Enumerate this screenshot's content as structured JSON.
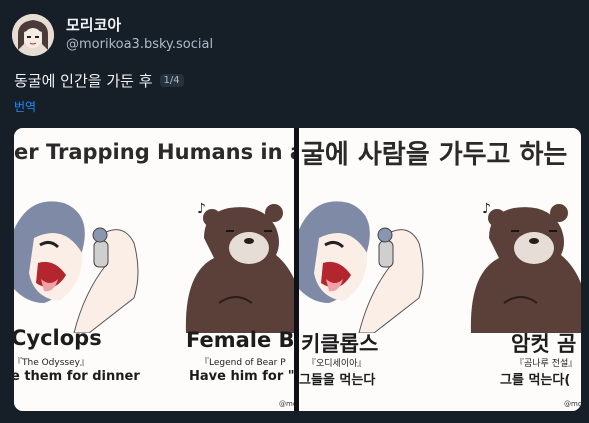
{
  "post": {
    "display_name": "모리코아",
    "handle": "@morikoa3.bsky.social",
    "text": "동굴에 인간을 가둔 후",
    "image_counter": "1/4",
    "translate_label": "번역"
  },
  "image": {
    "english_panel": {
      "headline": "ter Trapping Humans in a Ca",
      "left_name": "Cyclops",
      "left_source": "『The Odyssey』",
      "left_line": "e them for dinner",
      "right_name": "Female B",
      "right_source": "『Legend of Bear P",
      "right_line": "Have him for \"din",
      "credit": "@mo"
    },
    "korean_panel": {
      "headline": "굴에 사람을 가두고 하는",
      "left_name": "키클롭스",
      "left_source": "『오디세이아』",
      "left_line": "그들을 먹는다",
      "right_name": "암컷 곰",
      "right_source": "『곰나루 전설』",
      "right_line": "그를 먹는다(",
      "credit": "@mo"
    },
    "sfx": "♪"
  },
  "colors": {
    "background": "#161e27",
    "link": "#208bfe",
    "bear": "#5a4038",
    "hair": "#7e8aa6"
  }
}
